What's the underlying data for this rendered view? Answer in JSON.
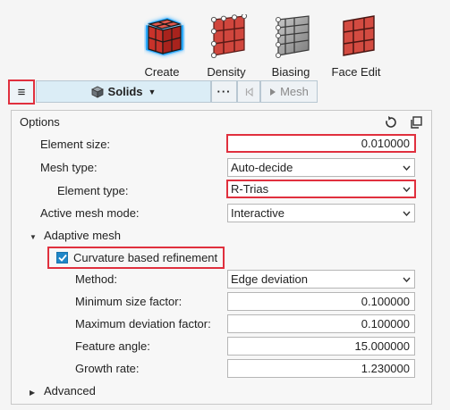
{
  "ribbon": {
    "tools": [
      {
        "label": "Create",
        "icon": "create-cube-icon"
      },
      {
        "label": "Density",
        "icon": "density-mesh-icon"
      },
      {
        "label": "Biasing",
        "icon": "biasing-mesh-icon"
      },
      {
        "label": "Face Edit",
        "icon": "face-edit-icon"
      }
    ]
  },
  "toolbar": {
    "menu_glyph": "≡",
    "solids_label": "Solids",
    "more_label": "···",
    "prev_glyph": "⊲",
    "mesh_label": "Mesh"
  },
  "options": {
    "title": "Options",
    "element_size": {
      "label": "Element size:",
      "value": "0.010000"
    },
    "mesh_type": {
      "label": "Mesh type:",
      "value": "Auto-decide"
    },
    "element_type": {
      "label": "Element type:",
      "value": "R-Trias"
    },
    "active_mesh_mode": {
      "label": "Active mesh mode:",
      "value": "Interactive"
    },
    "adaptive_mesh": {
      "label": "Adaptive mesh",
      "curvature_refinement": {
        "label": "Curvature based refinement",
        "checked": true
      },
      "method": {
        "label": "Method:",
        "value": "Edge deviation"
      },
      "min_size_factor": {
        "label": "Minimum size factor:",
        "value": "0.100000"
      },
      "max_deviation_factor": {
        "label": "Maximum deviation factor:",
        "value": "0.100000"
      },
      "feature_angle": {
        "label": "Feature angle:",
        "value": "15.000000"
      },
      "growth_rate": {
        "label": "Growth rate:",
        "value": "1.230000"
      }
    },
    "advanced": {
      "label": "Advanced"
    }
  },
  "colors": {
    "accent_red": "#e0303e",
    "toolbar_blue": "#dbedf6",
    "checkbox_blue": "#1f86c8",
    "create_glow": "#2aa9ff"
  }
}
